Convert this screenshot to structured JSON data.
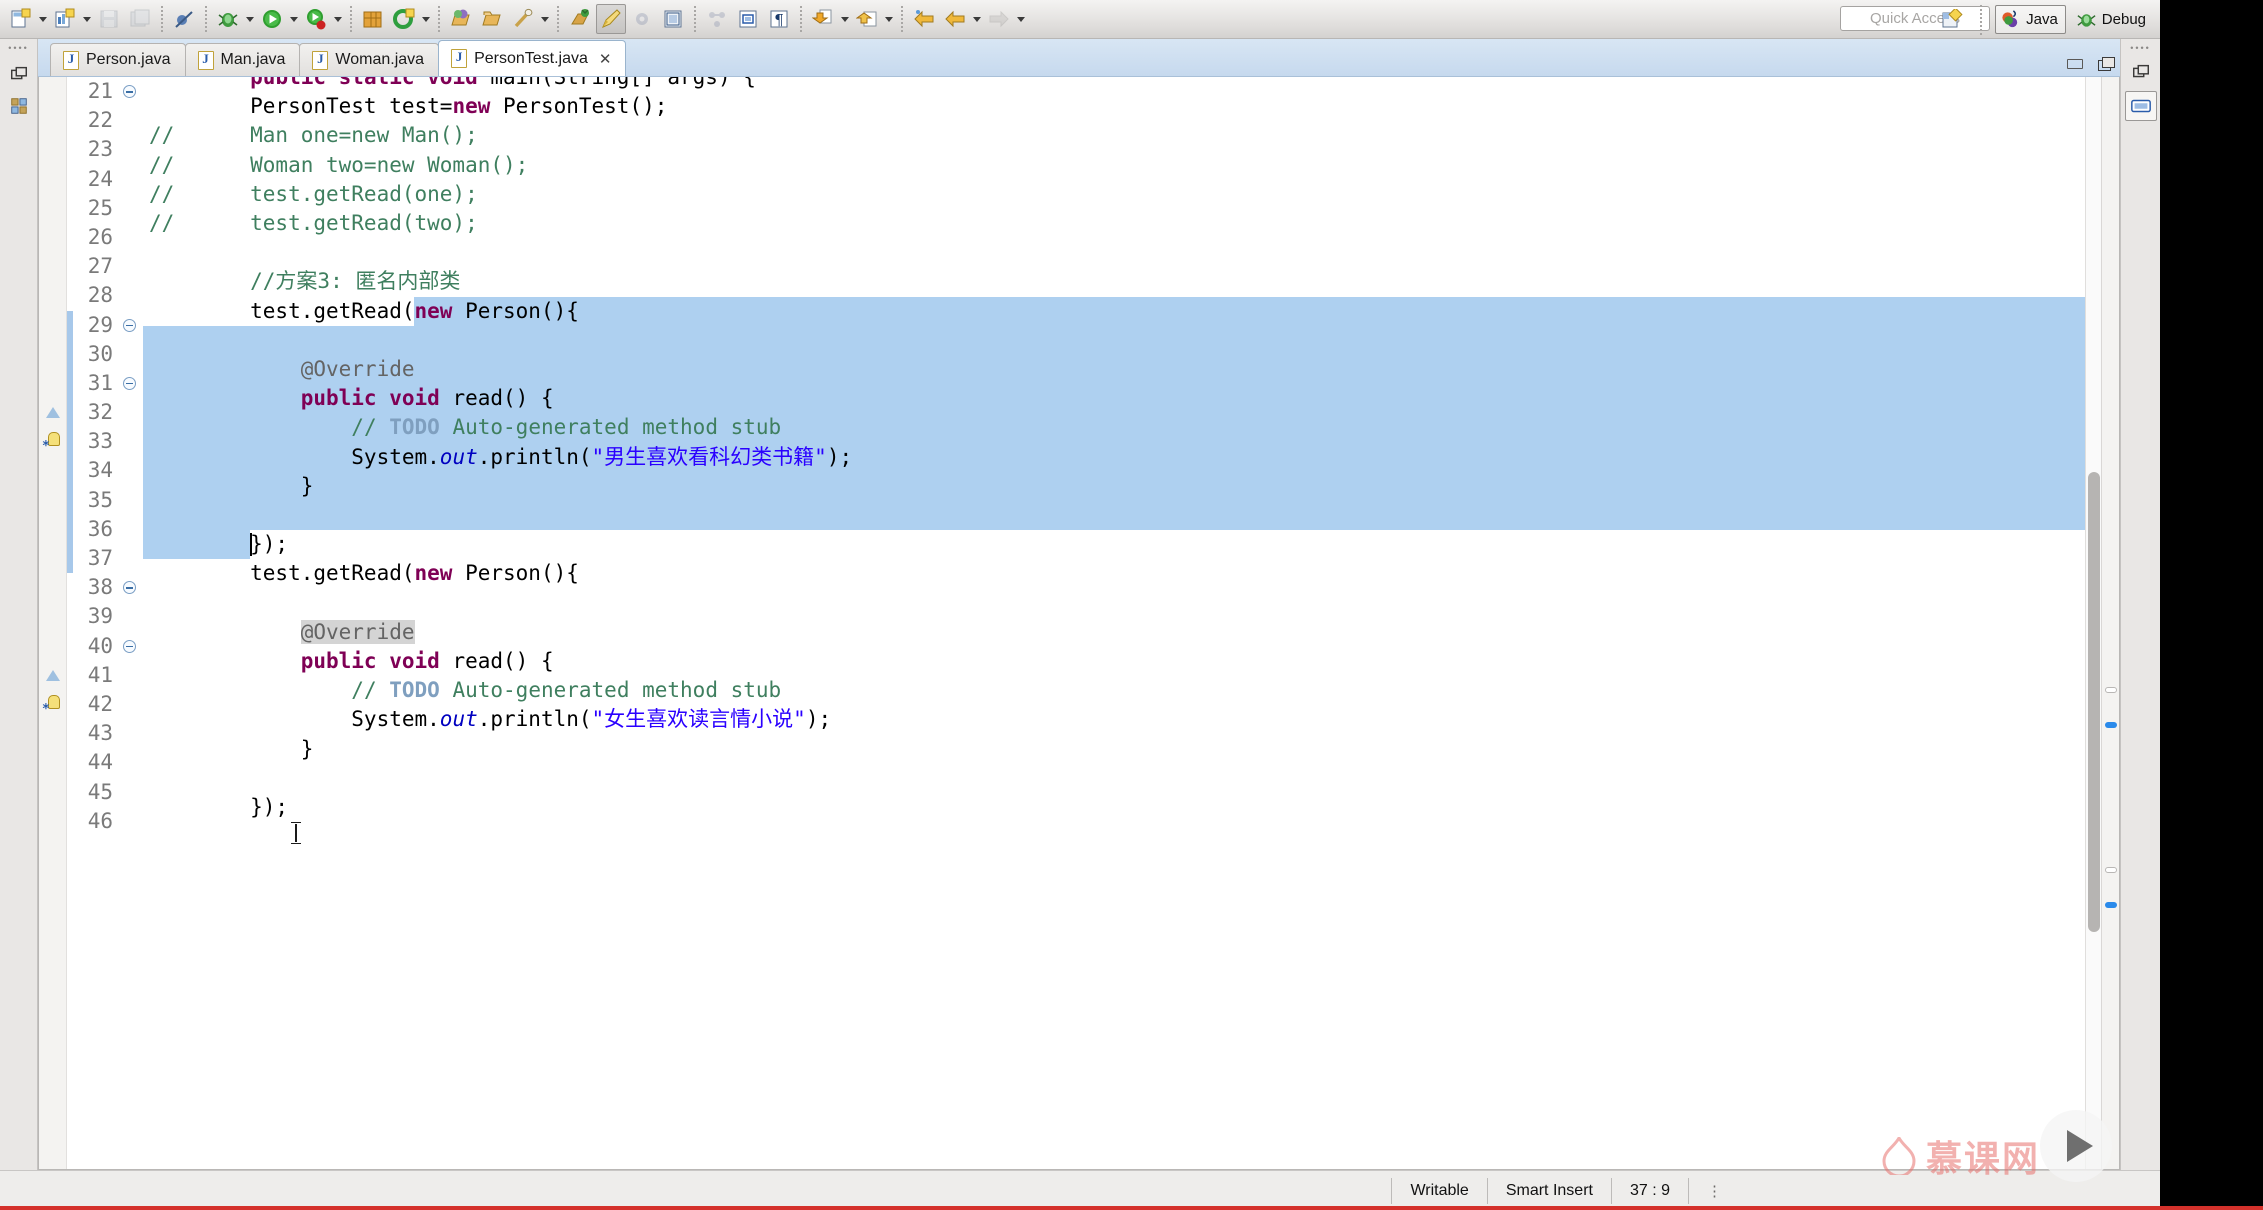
{
  "toolbar": {
    "icons": [
      {
        "name": "new-file-icon",
        "label": "New"
      },
      {
        "name": "new-wizard-icon",
        "label": "New Wizard"
      },
      {
        "name": "save-icon",
        "label": "Save"
      },
      {
        "name": "save-all-icon",
        "label": "Save All"
      },
      {
        "name": "toggle-breakpoint-icon",
        "label": "Skip All Breakpoints"
      },
      {
        "name": "debug-icon",
        "label": "Debug"
      },
      {
        "name": "run-icon",
        "label": "Run"
      },
      {
        "name": "coverage-icon",
        "label": "Coverage"
      },
      {
        "name": "new-package-icon",
        "label": "New Java Package"
      },
      {
        "name": "new-class-icon",
        "label": "New Java Class"
      },
      {
        "name": "open-type-icon",
        "label": "Open Type"
      },
      {
        "name": "open-task-icon",
        "label": "Open Task"
      },
      {
        "name": "search-icon",
        "label": "Search"
      },
      {
        "name": "link-editor-icon",
        "label": "Link Editor"
      },
      {
        "name": "pin-editor-icon",
        "label": "Pin Editor"
      },
      {
        "name": "external-tools-icon",
        "label": "External Tools"
      },
      {
        "name": "next-annotation-icon",
        "label": "Next Annotation"
      },
      {
        "name": "previous-annotation-icon",
        "label": "Previous Annotation"
      },
      {
        "name": "back-icon",
        "label": "Back"
      },
      {
        "name": "forward-icon",
        "label": "Forward"
      }
    ],
    "quick_access_placeholder": "Quick Access",
    "perspectives": [
      {
        "name": "java",
        "label": "Java"
      },
      {
        "name": "debug",
        "label": "Debug"
      }
    ],
    "open_perspective_label": ""
  },
  "tabs": [
    {
      "label": "Person.java",
      "active": false,
      "closable": false
    },
    {
      "label": "Man.java",
      "active": false,
      "closable": false
    },
    {
      "label": "Woman.java",
      "active": false,
      "closable": false
    },
    {
      "label": "PersonTest.java",
      "active": true,
      "closable": true,
      "close_glyph": "✕"
    }
  ],
  "editor": {
    "first_visible_line": 21,
    "lines": [
      {
        "n": 21,
        "fold": "minus",
        "clipped": true,
        "tokens": [
          {
            "t": "        ",
            "c": "pl"
          },
          {
            "t": "public static void ",
            "c": "kw2"
          },
          {
            "t": "main(String[] args) {",
            "c": "pl"
          }
        ]
      },
      {
        "n": 22,
        "tokens": [
          {
            "t": "        PersonTest test=",
            "c": "pl"
          },
          {
            "t": "new",
            "c": "kw2"
          },
          {
            "t": " PersonTest();",
            "c": "pl"
          }
        ]
      },
      {
        "n": 23,
        "tokens": [
          {
            "t": "//      Man one=new Man();",
            "c": "cmt"
          }
        ]
      },
      {
        "n": 24,
        "tokens": [
          {
            "t": "//      Woman two=new Woman();",
            "c": "cmt"
          }
        ]
      },
      {
        "n": 25,
        "tokens": [
          {
            "t": "//      test.getRead(one);",
            "c": "cmt"
          }
        ]
      },
      {
        "n": 26,
        "tokens": [
          {
            "t": "//      test.getRead(two);",
            "c": "cmt"
          }
        ]
      },
      {
        "n": 27,
        "tokens": []
      },
      {
        "n": 28,
        "tokens": [
          {
            "t": "        //方案3: 匿名内部类",
            "c": "cmt"
          }
        ]
      },
      {
        "n": 29,
        "fold": "minus",
        "sel_from": 21,
        "tokens": [
          {
            "t": "        test.getRead(",
            "c": "pl"
          },
          {
            "t": "new",
            "c": "kw2"
          },
          {
            "t": " Person(){",
            "c": "pl"
          }
        ]
      },
      {
        "n": 30,
        "selected": true,
        "tokens": []
      },
      {
        "n": 31,
        "fold": "minus",
        "selected": true,
        "tokens": [
          {
            "t": "            ",
            "c": "pl"
          },
          {
            "t": "@Override",
            "c": "ann"
          }
        ]
      },
      {
        "n": 32,
        "annot": "warn",
        "selected": true,
        "tokens": [
          {
            "t": "            ",
            "c": "pl"
          },
          {
            "t": "public void ",
            "c": "kw2"
          },
          {
            "t": "read() {",
            "c": "pl"
          }
        ]
      },
      {
        "n": 33,
        "annot": "bulb",
        "selected": true,
        "tokens": [
          {
            "t": "                ",
            "c": "pl"
          },
          {
            "t": "// ",
            "c": "cmt"
          },
          {
            "t": "TODO",
            "c": "todo"
          },
          {
            "t": " Auto-generated method stub",
            "c": "cmt"
          }
        ]
      },
      {
        "n": 34,
        "selected": true,
        "tokens": [
          {
            "t": "                System.",
            "c": "pl"
          },
          {
            "t": "out",
            "c": "fld"
          },
          {
            "t": ".println(",
            "c": "pl"
          },
          {
            "t": "\"男生喜欢看科幻类书籍\"",
            "c": "str"
          },
          {
            "t": ");",
            "c": "pl"
          }
        ]
      },
      {
        "n": 35,
        "selected": true,
        "tokens": [
          {
            "t": "            }",
            "c": "pl"
          }
        ]
      },
      {
        "n": 36,
        "selected": true,
        "tokens": []
      },
      {
        "n": 37,
        "sel_to": 8,
        "caret_col": 8,
        "tokens": [
          {
            "t": "        });",
            "c": "pl"
          }
        ]
      },
      {
        "n": 38,
        "fold": "minus",
        "tokens": [
          {
            "t": "        test.getRead(",
            "c": "pl"
          },
          {
            "t": "new",
            "c": "kw2"
          },
          {
            "t": " Person(){",
            "c": "pl"
          }
        ]
      },
      {
        "n": 39,
        "tokens": []
      },
      {
        "n": 40,
        "fold": "minus",
        "occurrence": true,
        "tokens": [
          {
            "t": "            ",
            "c": "pl"
          },
          {
            "t": "@Override",
            "c": "ann"
          }
        ]
      },
      {
        "n": 41,
        "annot": "warn",
        "tokens": [
          {
            "t": "            ",
            "c": "pl"
          },
          {
            "t": "public void ",
            "c": "kw2"
          },
          {
            "t": "read() {",
            "c": "pl"
          }
        ]
      },
      {
        "n": 42,
        "annot": "bulb",
        "tokens": [
          {
            "t": "                ",
            "c": "pl"
          },
          {
            "t": "// ",
            "c": "cmt"
          },
          {
            "t": "TODO",
            "c": "todo"
          },
          {
            "t": " Auto-generated method stub",
            "c": "cmt"
          }
        ]
      },
      {
        "n": 43,
        "tokens": [
          {
            "t": "                System.",
            "c": "pl"
          },
          {
            "t": "out",
            "c": "fld"
          },
          {
            "t": ".println(",
            "c": "pl"
          },
          {
            "t": "\"女生喜欢读言情小说\"",
            "c": "str"
          },
          {
            "t": ");",
            "c": "pl"
          }
        ]
      },
      {
        "n": 44,
        "tokens": [
          {
            "t": "            }",
            "c": "pl"
          }
        ]
      },
      {
        "n": 45,
        "tokens": []
      },
      {
        "n": 46,
        "clipped_bottom": true,
        "tokens": [
          {
            "t": "        });",
            "c": "pl"
          }
        ]
      }
    ]
  },
  "status_bar": {
    "writable": "Writable",
    "insert_mode": "Smart Insert",
    "position": "37 : 9",
    "overflow_glyph": "⋮"
  },
  "watermark": {
    "text": "慕课网",
    "play_button_name": "play-button"
  }
}
